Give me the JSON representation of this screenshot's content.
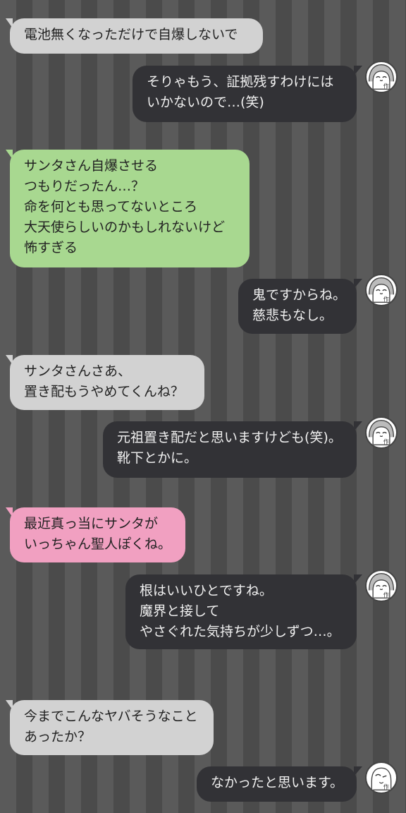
{
  "messages": [
    {
      "side": "left",
      "color": "gray",
      "lines": [
        "電池無くなっただけで自爆しないで"
      ]
    },
    {
      "side": "right",
      "color": "dark",
      "lines": [
        "そりゃもう、証拠残すわけには",
        "いかないので…(笑)"
      ]
    },
    {
      "side": "left",
      "color": "green",
      "lines": [
        "サンタさん自爆させる",
        "つもりだったん…？",
        "命を何とも思ってないところ",
        "大天使らしいのかもしれないけど",
        "怖すぎる"
      ]
    },
    {
      "side": "right",
      "color": "dark",
      "lines": [
        "鬼ですからね。",
        "慈悲もなし。"
      ]
    },
    {
      "side": "left",
      "color": "gray",
      "lines": [
        "サンタさんさあ、",
        "置き配もうやめてくんね？"
      ]
    },
    {
      "side": "right",
      "color": "dark",
      "lines": [
        "元祖置き配だと思いますけども(笑)。",
        "靴下とかに。"
      ]
    },
    {
      "side": "left",
      "color": "pink",
      "lines": [
        "最近真っ当にサンタが",
        "いっちゃん聖人ぽくね。"
      ]
    },
    {
      "side": "right",
      "color": "dark",
      "lines": [
        "根はいいひとですね。",
        "魔界と接して",
        "やさぐれた気持ちが少しずつ…。"
      ]
    },
    {
      "side": "left",
      "color": "gray",
      "lines": [
        "今までこんなヤバそうなこと",
        "あったか？"
      ]
    },
    {
      "side": "right",
      "color": "dark",
      "lines": [
        "なかったと思います。"
      ]
    }
  ],
  "avatar": {
    "icon": "writer-face-icon",
    "badge": "作"
  }
}
